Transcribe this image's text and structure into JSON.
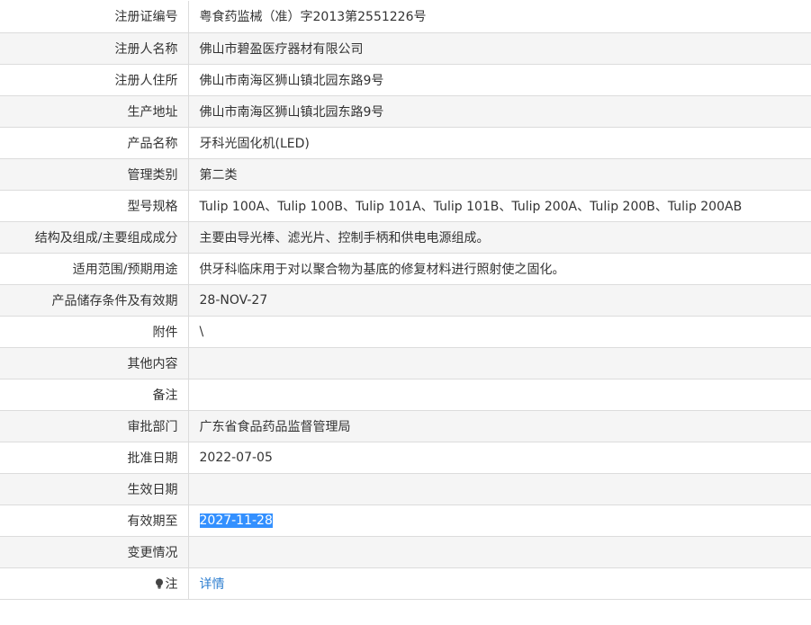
{
  "rows": [
    {
      "label": "注册证编号",
      "value": "粤食药监械（准）字2013第2551226号"
    },
    {
      "label": "注册人名称",
      "value": "佛山市碧盈医疗器材有限公司"
    },
    {
      "label": "注册人住所",
      "value": "佛山市南海区狮山镇北园东路9号"
    },
    {
      "label": "生产地址",
      "value": "佛山市南海区狮山镇北园东路9号"
    },
    {
      "label": "产品名称",
      "value": "牙科光固化机(LED)"
    },
    {
      "label": "管理类别",
      "value": "第二类"
    },
    {
      "label": "型号规格",
      "value": "Tulip 100A、Tulip 100B、Tulip 101A、Tulip 101B、Tulip 200A、Tulip 200B、Tulip 200AB"
    },
    {
      "label": "结构及组成/主要组成成分",
      "value": "主要由导光棒、滤光片、控制手柄和供电电源组成。"
    },
    {
      "label": "适用范围/预期用途",
      "value": "供牙科临床用于对以聚合物为基底的修复材料进行照射使之固化。"
    },
    {
      "label": "产品储存条件及有效期",
      "value": "28-NOV-27"
    },
    {
      "label": "附件",
      "value": "\\"
    },
    {
      "label": "其他内容",
      "value": ""
    },
    {
      "label": "备注",
      "value": ""
    },
    {
      "label": "审批部门",
      "value": "广东省食品药品监督管理局"
    },
    {
      "label": "批准日期",
      "value": "2022-07-05"
    },
    {
      "label": "生效日期",
      "value": ""
    },
    {
      "label": "有效期至",
      "value": "2027-11-28"
    },
    {
      "label": "变更情况",
      "value": ""
    },
    {
      "label": "注",
      "value": "详情",
      "icon": "lightbulb-icon"
    }
  ]
}
